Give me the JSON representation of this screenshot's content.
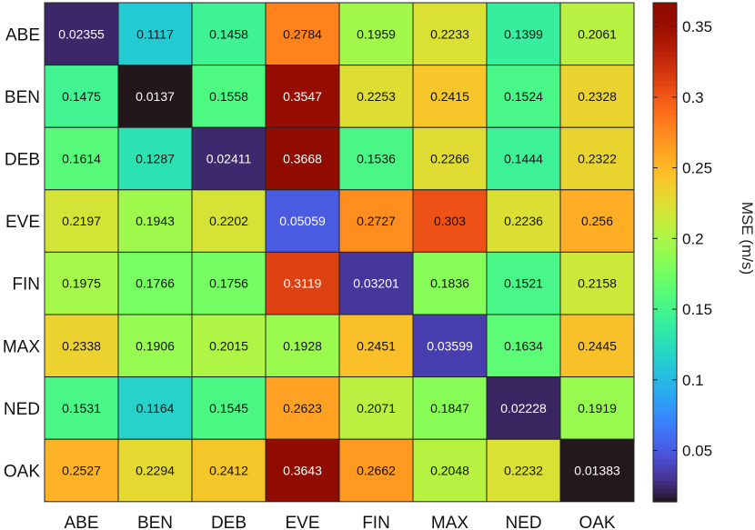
{
  "chart_data": {
    "type": "heatmap",
    "title": "",
    "xlabel": "",
    "ylabel": "",
    "x_categories": [
      "ABE",
      "BEN",
      "DEB",
      "EVE",
      "FIN",
      "MAX",
      "NED",
      "OAK"
    ],
    "y_categories": [
      "ABE",
      "BEN",
      "DEB",
      "EVE",
      "FIN",
      "MAX",
      "NED",
      "OAK"
    ],
    "values": [
      [
        0.02355,
        0.1117,
        0.1458,
        0.2784,
        0.1959,
        0.2233,
        0.1399,
        0.2061
      ],
      [
        0.1475,
        0.0137,
        0.1558,
        0.3547,
        0.2253,
        0.2415,
        0.1524,
        0.2328
      ],
      [
        0.1614,
        0.1287,
        0.02411,
        0.3668,
        0.1536,
        0.2266,
        0.1444,
        0.2322
      ],
      [
        0.2197,
        0.1943,
        0.2202,
        0.05059,
        0.2727,
        0.303,
        0.2236,
        0.256
      ],
      [
        0.1975,
        0.1766,
        0.1756,
        0.3119,
        0.03201,
        0.1836,
        0.1521,
        0.2158
      ],
      [
        0.2338,
        0.1906,
        0.2015,
        0.1928,
        0.2451,
        0.03599,
        0.1634,
        0.2445
      ],
      [
        0.1531,
        0.1164,
        0.1545,
        0.2623,
        0.2071,
        0.1847,
        0.02228,
        0.1919
      ],
      [
        0.2527,
        0.2294,
        0.2412,
        0.3643,
        0.2662,
        0.2048,
        0.2232,
        0.01383
      ]
    ],
    "value_labels": [
      [
        "0.02355",
        "0.1117",
        "0.1458",
        "0.2784",
        "0.1959",
        "0.2233",
        "0.1399",
        "0.2061"
      ],
      [
        "0.1475",
        "0.0137",
        "0.1558",
        "0.3547",
        "0.2253",
        "0.2415",
        "0.1524",
        "0.2328"
      ],
      [
        "0.1614",
        "0.1287",
        "0.02411",
        "0.3668",
        "0.1536",
        "0.2266",
        "0.1444",
        "0.2322"
      ],
      [
        "0.2197",
        "0.1943",
        "0.2202",
        "0.05059",
        "0.2727",
        "0.303",
        "0.2236",
        "0.256"
      ],
      [
        "0.1975",
        "0.1766",
        "0.1756",
        "0.3119",
        "0.03201",
        "0.1836",
        "0.1521",
        "0.2158"
      ],
      [
        "0.2338",
        "0.1906",
        "0.2015",
        "0.1928",
        "0.2451",
        "0.03599",
        "0.1634",
        "0.2445"
      ],
      [
        "0.1531",
        "0.1164",
        "0.1545",
        "0.2623",
        "0.2071",
        "0.1847",
        "0.02228",
        "0.1919"
      ],
      [
        "0.2527",
        "0.2294",
        "0.2412",
        "0.3643",
        "0.2662",
        "0.2048",
        "0.2232",
        "0.01383"
      ]
    ],
    "colormap": "turbo",
    "color_range": [
      0.0137,
      0.3668
    ],
    "colorbar": {
      "label": "MSE (m/s)",
      "ticks": [
        0.05,
        0.1,
        0.15,
        0.2,
        0.25,
        0.3,
        0.35
      ],
      "tick_labels": [
        "0.05",
        "0.1",
        "0.15",
        "0.2",
        "0.25",
        "0.3",
        "0.35"
      ]
    },
    "grid": true,
    "legend": "colorbar-right"
  }
}
